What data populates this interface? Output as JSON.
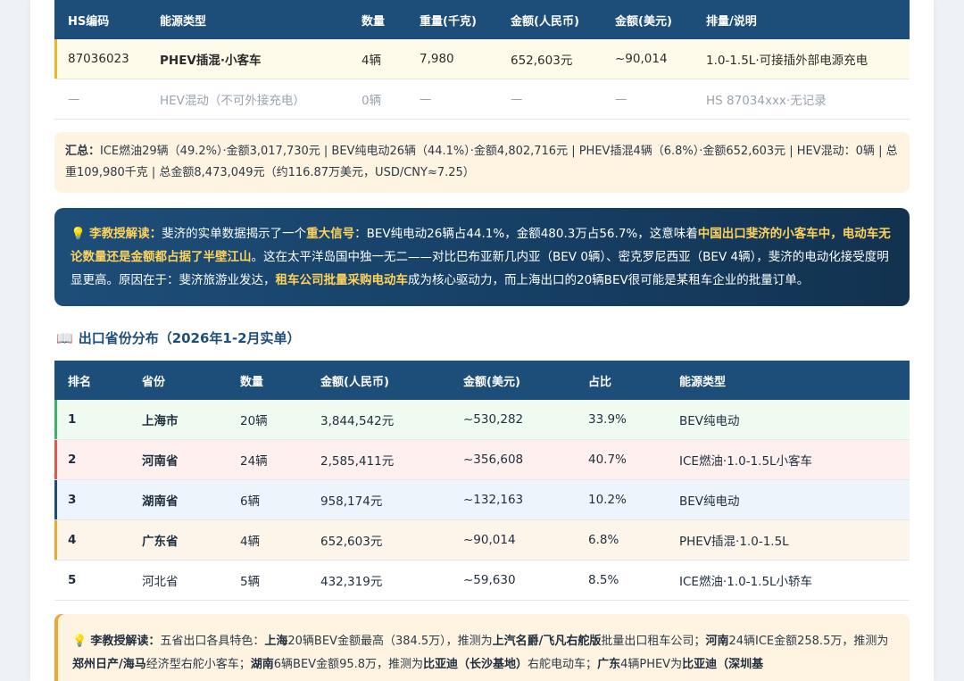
{
  "table1": {
    "headers": [
      "HS编码",
      "能源类型",
      "数量",
      "重量(千克)",
      "金额(人民币)",
      "金额(美元)",
      "排量/说明"
    ],
    "rows": [
      [
        "87036023",
        "PHEV插混·小客车",
        "4辆",
        "7,980",
        "652,603元",
        "~90,014",
        "1.0-1.5L·可接插外部电源充电"
      ],
      [
        "—",
        "HEV混动（不可外接充电）",
        "0辆",
        "—",
        "—",
        "—",
        "HS 87034xxx·无记录"
      ]
    ]
  },
  "summary": {
    "label": "汇总：",
    "text": "ICE燃油29辆（49.2%）·金额3,017,730元 | BEV纯电动26辆（44.1%）·金额4,802,716元 | PHEV插混4辆（6.8%）·金额652,603元 | HEV混动：0辆 | 总重109,980千克 | 总金额8,473,049元（约116.87万美元，USD/CNY≈7.25）"
  },
  "insight1": {
    "icon": "💡",
    "lead": "李教授解读：",
    "t1": "斐济的实单数据揭示了一个",
    "h1": "重大信号",
    "t2": "：BEV纯电动26辆占44.1%，金额480.3万占56.7%，这意味着",
    "h2": "中国出口斐济的小客车中，电动车无论数量还是金额都占据了半壁江山",
    "t3": "。这在太平洋岛国中独一无二——对比巴布亚新几内亚（BEV 0辆）、密克罗尼西亚（BEV 4辆），斐济的电动化接受度明显更高。原因在于：斐济旅游业发达，",
    "h3": "租车公司批量采购电动车",
    "t4": "成为核心驱动力，而上海出口的20辆BEV很可能是某租车企业的批量订单。"
  },
  "section2": {
    "icon": "📖",
    "title": "出口省份分布（2026年1-2月实单）"
  },
  "table2": {
    "headers": [
      "排名",
      "省份",
      "数量",
      "金额(人民币)",
      "金额(美元)",
      "占比",
      "能源类型"
    ],
    "rows": [
      [
        "1",
        "上海市",
        "20辆",
        "3,844,542元",
        "~530,282",
        "33.9%",
        "BEV纯电动"
      ],
      [
        "2",
        "河南省",
        "24辆",
        "2,585,411元",
        "~356,608",
        "40.7%",
        "ICE燃油·1.0-1.5L小客车"
      ],
      [
        "3",
        "湖南省",
        "6辆",
        "958,174元",
        "~132,163",
        "10.2%",
        "BEV纯电动"
      ],
      [
        "4",
        "广东省",
        "4辆",
        "652,603元",
        "~90,014",
        "6.8%",
        "PHEV插混·1.0-1.5L"
      ],
      [
        "5",
        "河北省",
        "5辆",
        "432,319元",
        "~59,630",
        "8.5%",
        "ICE燃油·1.0-1.5L小轿车"
      ]
    ]
  },
  "insight2": {
    "icon": "💡",
    "lead": "李教授解读：",
    "t1": "五省出口各具特色：",
    "b1": "上海",
    "t2": "20辆BEV金额最高（384.5万），推测为",
    "b2": "上汽名爵/飞凡右舵版",
    "t3": "批量出口租车公司；",
    "b3": "河南",
    "t4": "24辆ICE金额258.5万，推测为",
    "b4": "郑州日产/海马",
    "t5": "经济型右舵小客车；",
    "b5": "湖南",
    "t6": "6辆BEV金额95.8万，推测为",
    "b6": "比亚迪（长沙基地）",
    "t7": "右舵电动车；",
    "b7": "广东",
    "t8": "4辆PHEV为",
    "b8": "比亚迪（深圳基"
  }
}
